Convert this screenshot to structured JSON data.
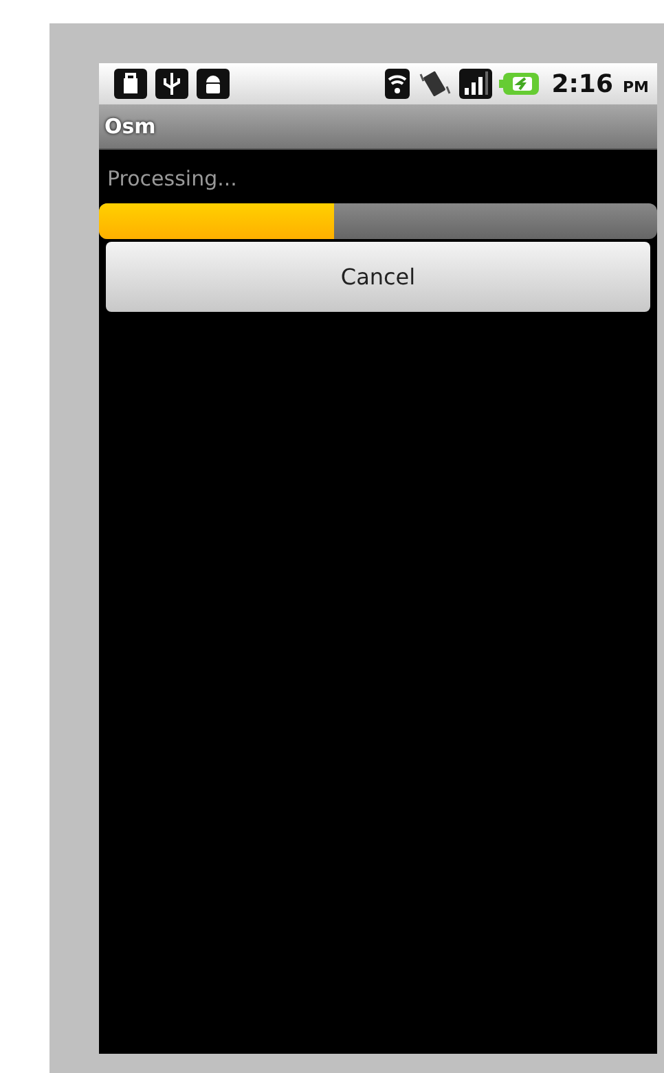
{
  "status_bar": {
    "time": "2:16",
    "ampm": "PM"
  },
  "title": "Osm",
  "progress": {
    "message": "Processing...",
    "level": 0.42
  },
  "buttons": [
    {
      "label": "Cancel"
    }
  ]
}
